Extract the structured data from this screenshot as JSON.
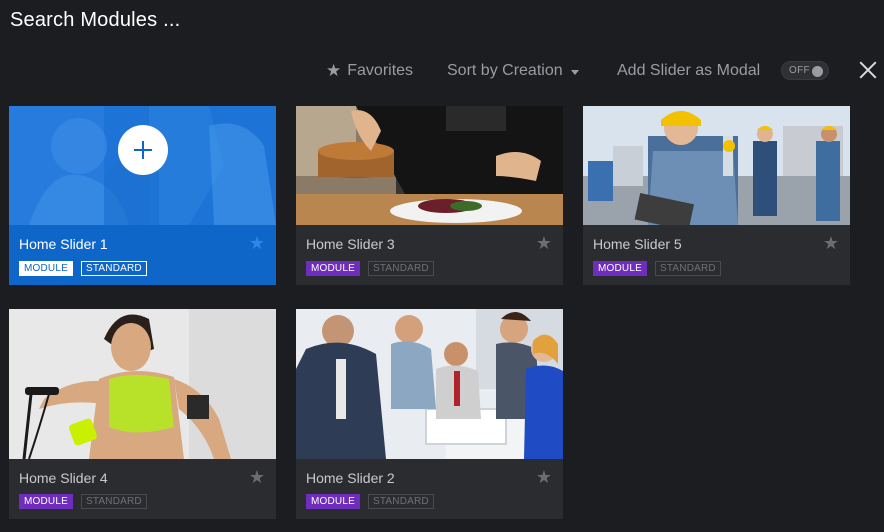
{
  "header": {
    "title": "Search Modules ..."
  },
  "toolbar": {
    "favorites_label": "Favorites",
    "sort_label": "Sort by Creation",
    "modal_label": "Add Slider as Modal",
    "modal_toggle": "OFF"
  },
  "tags": {
    "module": "MODULE",
    "standard": "STANDARD"
  },
  "cards": [
    {
      "name": "Home Slider 1",
      "image": "add-new",
      "selected": true
    },
    {
      "name": "Home Slider 3",
      "image": "chef-plating-food"
    },
    {
      "name": "Home Slider 5",
      "image": "construction-workers"
    },
    {
      "name": "Home Slider 4",
      "image": "fitness-woman-jump-rope"
    },
    {
      "name": "Home Slider 2",
      "image": "business-meeting"
    }
  ],
  "colors": {
    "accent": "#0f66c9",
    "module_tag": "#6f2dbd",
    "background": "#1c1d20"
  }
}
